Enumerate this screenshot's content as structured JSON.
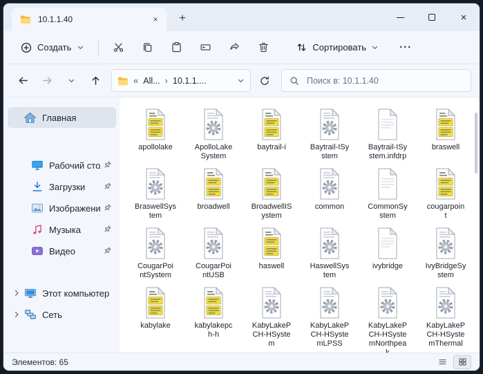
{
  "glyphs": {
    "close": "×",
    "tab_close": "×",
    "new_tab": "+"
  },
  "tab_bar": {
    "tab_title": "10.1.1.40"
  },
  "toolbar": {
    "new_label": "Создать",
    "icons": [
      "cut",
      "copy",
      "paste",
      "rename",
      "share",
      "delete"
    ],
    "sort_label": "Сортировать",
    "more_label": "···"
  },
  "address_bar": {
    "breadcrumb": {
      "overflow": "«",
      "segment1": "All...",
      "separator": "›",
      "segment2": "10.1.1...."
    },
    "search_placeholder": "Поиск в: 10.1.1.40"
  },
  "sidebar": {
    "items": [
      {
        "id": "home",
        "label": "Главная",
        "icon": "home",
        "selected": true
      },
      {
        "id": "desktop",
        "label": "Рабочий стол",
        "icon": "desktop",
        "pinned": true,
        "indent": true,
        "gap_before": 38
      },
      {
        "id": "downloads",
        "label": "Загрузки",
        "icon": "downloads",
        "pinned": true,
        "indent": true
      },
      {
        "id": "pictures",
        "label": "Изображения",
        "icon": "pictures",
        "pinned": true,
        "indent": true
      },
      {
        "id": "music",
        "label": "Музыка",
        "icon": "music",
        "pinned": true,
        "indent": true
      },
      {
        "id": "videos",
        "label": "Видео",
        "icon": "videos",
        "pinned": true,
        "indent": true
      },
      {
        "id": "computer",
        "label": "Этот компьютер",
        "icon": "computer",
        "expandable": true,
        "gap_before": 30
      },
      {
        "id": "network",
        "label": "Сеть",
        "icon": "network",
        "expandable": true
      }
    ]
  },
  "files": [
    {
      "name": "apollolake",
      "type": "inf",
      "lines": [
        "apollolake"
      ]
    },
    {
      "name": "ApolloLakeSystem",
      "type": "system",
      "lines": [
        "ApolloLake",
        "System"
      ]
    },
    {
      "name": "baytrail-i",
      "type": "inf",
      "lines": [
        "baytrail-i"
      ]
    },
    {
      "name": "Baytrail-ISystem",
      "type": "system",
      "lines": [
        "Baytrail-ISy",
        "stem"
      ]
    },
    {
      "name": "Baytrail-ISystem.infdrp",
      "type": "doc",
      "lines": [
        "Baytrail-ISy",
        "stem.infdrp"
      ]
    },
    {
      "name": "braswell",
      "type": "inf",
      "lines": [
        "braswell"
      ]
    },
    {
      "name": "BraswellSystem",
      "type": "system",
      "lines": [
        "BraswellSys",
        "tem"
      ]
    },
    {
      "name": "broadwell",
      "type": "inf",
      "lines": [
        "broadwell"
      ]
    },
    {
      "name": "BroadwellISystem",
      "type": "inf",
      "lines": [
        "BroadwellIS",
        "ystem"
      ]
    },
    {
      "name": "common",
      "type": "system",
      "lines": [
        "common"
      ]
    },
    {
      "name": "CommonSystem",
      "type": "doc",
      "lines": [
        "CommonSy",
        "stem"
      ]
    },
    {
      "name": "cougarpoint",
      "type": "inf",
      "lines": [
        "cougarpoin",
        "t"
      ]
    },
    {
      "name": "CougarPointSystem",
      "type": "system",
      "lines": [
        "CougarPoi",
        "ntSystem"
      ]
    },
    {
      "name": "CougarPointUSB",
      "type": "system",
      "lines": [
        "CougarPoi",
        "ntUSB"
      ]
    },
    {
      "name": "haswell",
      "type": "inf",
      "lines": [
        "haswell"
      ]
    },
    {
      "name": "HaswellSystem",
      "type": "system",
      "lines": [
        "HaswellSys",
        "tem"
      ]
    },
    {
      "name": "ivybridge",
      "type": "doc",
      "lines": [
        "ivybridge"
      ]
    },
    {
      "name": "IvyBridgeSystem",
      "type": "system",
      "lines": [
        "IvyBridgeSy",
        "stem"
      ]
    },
    {
      "name": "kabylake",
      "type": "inf",
      "lines": [
        "kabylake"
      ]
    },
    {
      "name": "kabylakepch-h",
      "type": "inf",
      "lines": [
        "kabylakepc",
        "h-h"
      ]
    },
    {
      "name": "KabyLakePCH-HSystem",
      "type": "system",
      "lines": [
        "KabyLakeP",
        "CH-HSyste",
        "m"
      ]
    },
    {
      "name": "KabyLakePCH-HSystemLPSS",
      "type": "system",
      "lines": [
        "KabyLakeP",
        "CH-HSyste",
        "mLPSS"
      ]
    },
    {
      "name": "KabyLakePCH-HSystemNorthpeak",
      "type": "system",
      "lines": [
        "KabyLakeP",
        "CH-HSyste",
        "mNorthpea",
        "k"
      ]
    },
    {
      "name": "KabyLakePCH-HSystemThermal",
      "type": "system",
      "lines": [
        "KabyLakeP",
        "CH-HSyste",
        "mThermal"
      ]
    }
  ],
  "status_bar": {
    "items_count": "Элементов: 65"
  },
  "colors": {
    "folder_yellow": "#ffc843",
    "selection_bg": "#dfe5ef",
    "accent_blue": "#2f8fdd",
    "inf_yellow": "#f2de46"
  }
}
